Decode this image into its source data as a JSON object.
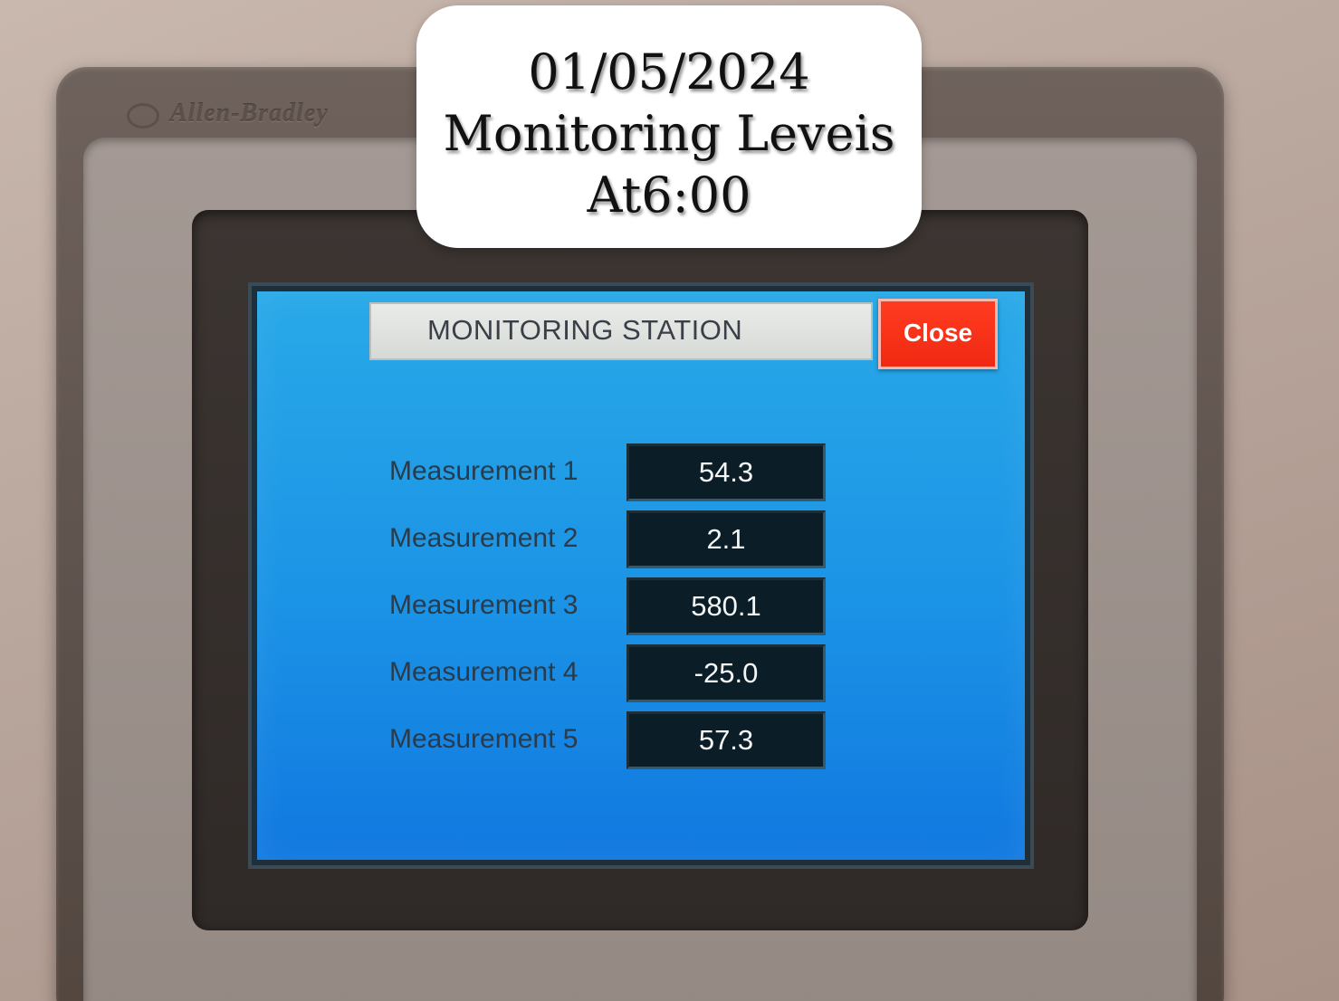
{
  "caption": {
    "date": "01/05/2024",
    "title": "Monitoring Leveis",
    "time": "At6:00"
  },
  "device": {
    "brand": "Allen-Bradley"
  },
  "screen": {
    "title": "MONITORING STATION",
    "close_label": "Close",
    "measurements": [
      {
        "label": "Measurement 1",
        "value": "54.3"
      },
      {
        "label": "Measurement 2",
        "value": "2.1"
      },
      {
        "label": "Measurement 3",
        "value": "580.1"
      },
      {
        "label": "Measurement 4",
        "value": "-25.0"
      },
      {
        "label": "Measurement 5",
        "value": "57.3"
      }
    ]
  },
  "colors": {
    "screen_background": "#1b93e6",
    "close_button": "#f02a12",
    "value_box": "#0b1d26"
  }
}
